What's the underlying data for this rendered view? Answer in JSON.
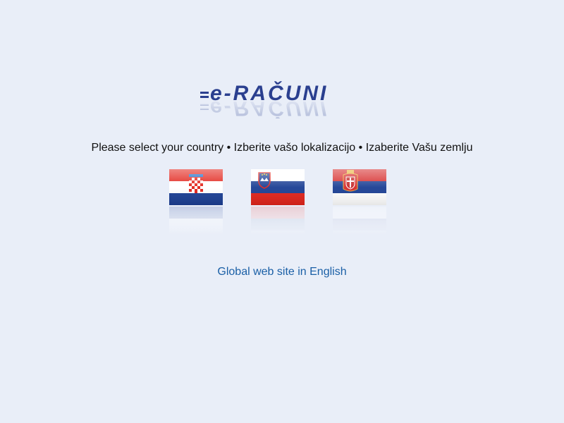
{
  "logo": {
    "text": "e-RAČUNI",
    "color": "#2a3f8f"
  },
  "prompt": {
    "text": "Please select your country • Izberite vašo lokalizacijo • Izaberite Vašu zemlju"
  },
  "countries": [
    {
      "name": "Croatia",
      "icon": "croatia-flag-icon",
      "colors": [
        "#e2231a",
        "#ffffff",
        "#1c3f94"
      ]
    },
    {
      "name": "Slovenia",
      "icon": "slovenia-flag-icon",
      "colors": [
        "#ffffff",
        "#1c3f94",
        "#e2231a"
      ]
    },
    {
      "name": "Serbia",
      "icon": "serbia-flag-icon",
      "colors": [
        "#d62b2b",
        "#1c3f94",
        "#ffffff"
      ]
    }
  ],
  "global_link": {
    "text": "Global web site in English",
    "color": "#1a5fa6"
  }
}
